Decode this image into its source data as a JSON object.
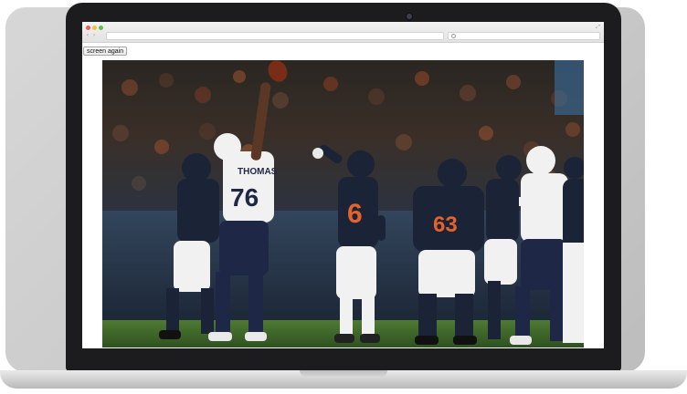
{
  "browser": {
    "buttons": {
      "screen_again_label": "screen again"
    }
  },
  "photo": {
    "jerseys": {
      "lineman_name": "THOMAS",
      "lineman_number": "76",
      "qb_number": "6",
      "center_number": "63"
    }
  },
  "colors": {
    "bears_navy": "#1b2336",
    "bears_orange": "#e4632a",
    "chargers_white": "#f1f1f1",
    "chargers_navy": "#1f2746",
    "field_green": "#3f6b2a"
  },
  "icons": [
    "search-icon",
    "resize-icon",
    "back-icon",
    "forward-icon",
    "new-tab-icon"
  ]
}
